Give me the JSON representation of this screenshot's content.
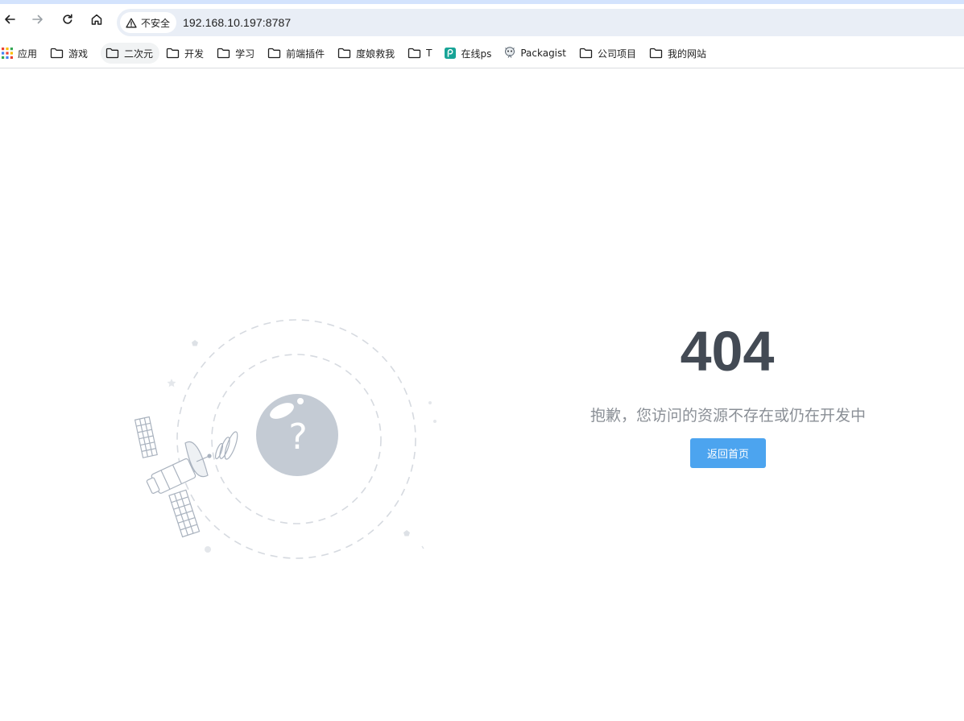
{
  "browser": {
    "security_label": "不安全",
    "url": "192.168.10.197:8787"
  },
  "bookmarks": [
    {
      "label": "应用",
      "icon": "apps-grid-icon"
    },
    {
      "label": "游戏",
      "icon": "folder-icon"
    },
    {
      "label": "二次元",
      "icon": "folder-icon"
    },
    {
      "label": "开发",
      "icon": "folder-icon"
    },
    {
      "label": "学习",
      "icon": "folder-icon"
    },
    {
      "label": "前端插件",
      "icon": "folder-icon"
    },
    {
      "label": "度娘救我",
      "icon": "folder-icon"
    },
    {
      "label": "T",
      "icon": "folder-icon"
    },
    {
      "label": "在线ps",
      "icon": "photopea-icon"
    },
    {
      "label": "Packagist",
      "icon": "packagist-icon"
    },
    {
      "label": "公司项目",
      "icon": "folder-icon"
    },
    {
      "label": "我的网站",
      "icon": "folder-icon"
    }
  ],
  "error_page": {
    "code": "404",
    "message": "抱歉，您访问的资源不存在或仍在开发中",
    "home_button_label": "返回首页",
    "illustration_glyph": "?"
  },
  "colors": {
    "accent_button": "#4ca4ef",
    "code_text": "#434a54",
    "message_text": "#8a8f96",
    "illustration_stroke": "#b4bcc8",
    "planet_fill": "#c4cbd4"
  }
}
